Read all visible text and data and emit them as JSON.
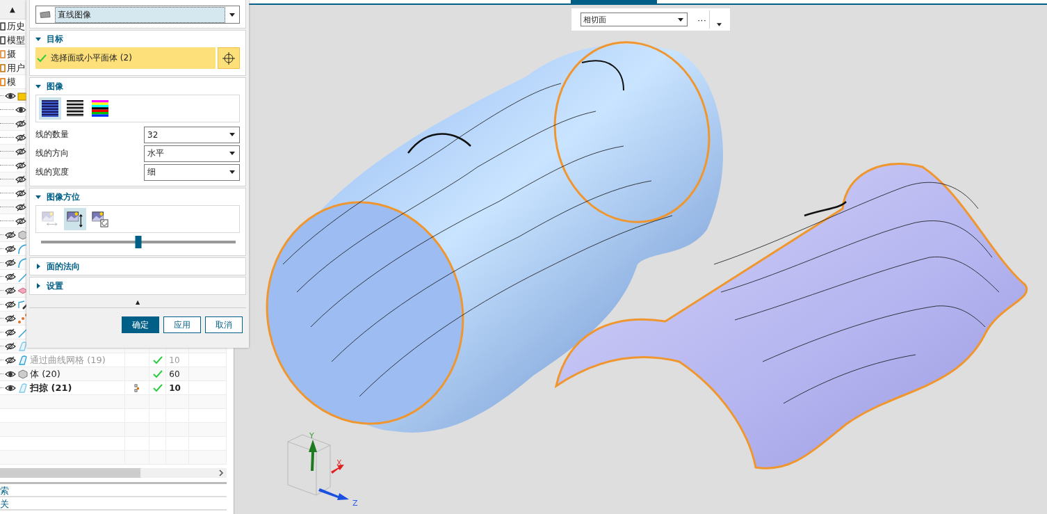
{
  "navigator": {
    "sort_arrow": "▲",
    "rows": [
      {
        "kind": "history",
        "label": "历史"
      },
      {
        "kind": "views",
        "label": "模型"
      },
      {
        "kind": "camera",
        "label": "摄"
      },
      {
        "kind": "expr",
        "label": "用户"
      },
      {
        "kind": "model",
        "label": "模"
      },
      {
        "kind": "folder",
        "shown": true
      },
      {
        "kind": "child",
        "shown": true
      },
      {
        "kind": "child",
        "shown": false
      },
      {
        "kind": "child",
        "shown": false
      },
      {
        "kind": "child",
        "shown": false
      },
      {
        "kind": "child",
        "shown": false
      },
      {
        "kind": "child",
        "shown": false
      },
      {
        "kind": "child",
        "shown": false
      },
      {
        "kind": "child",
        "shown": false
      },
      {
        "kind": "child",
        "shown": false
      },
      {
        "kind": "body",
        "shown": false
      },
      {
        "kind": "arc",
        "shown": false
      },
      {
        "kind": "arc",
        "shown": false
      },
      {
        "kind": "line",
        "shown": false
      },
      {
        "kind": "plane",
        "shown": false
      },
      {
        "kind": "sketch",
        "shown": false
      },
      {
        "kind": "points",
        "shown": false
      },
      {
        "kind": "line",
        "shown": false
      },
      {
        "kind": "sweep",
        "shown": false
      },
      {
        "kind": "mesh",
        "shown": false,
        "label": "通过曲线网格 (19)",
        "disabled": true,
        "current": false,
        "dependency": false,
        "check": true,
        "value": "10"
      },
      {
        "kind": "body",
        "shown": true,
        "label": "体 (20)",
        "disabled": false,
        "current": false,
        "dependency": false,
        "check": true,
        "value": "60"
      },
      {
        "kind": "sweep",
        "shown": true,
        "label": "扫掠 (21)",
        "disabled": false,
        "current": true,
        "dependency": true,
        "check": true,
        "value": "10"
      }
    ],
    "panels": [
      "索",
      "关"
    ]
  },
  "dialog": {
    "type_select": "直线图像",
    "target": {
      "title": "目标",
      "expanded": true,
      "selection": "选择面或小平面体 (2)",
      "complete": true
    },
    "image": {
      "title": "图像",
      "expanded": true,
      "styles": [
        {
          "kind": "blue",
          "selected": true
        },
        {
          "kind": "gray",
          "selected": false
        },
        {
          "kind": "color",
          "selected": false
        }
      ],
      "fields": [
        {
          "label": "线的数量",
          "value": "32"
        },
        {
          "label": "线的方向",
          "value": "水平"
        },
        {
          "label": "线的宽度",
          "value": "细"
        }
      ]
    },
    "orientation": {
      "title": "图像方位",
      "expanded": true,
      "modes": [
        {
          "kind": "pan",
          "selected": false,
          "disabled": true
        },
        {
          "kind": "vertical",
          "selected": true,
          "disabled": false
        },
        {
          "kind": "rotate",
          "selected": false,
          "disabled": false
        }
      ],
      "level": 0.5
    },
    "sections": [
      {
        "title": "面的法向",
        "expanded": false
      },
      {
        "title": "设置",
        "expanded": false
      }
    ],
    "collapse_arrow": "▲",
    "buttons": [
      {
        "label": "确定",
        "primary": true
      },
      {
        "label": "应用",
        "primary": false
      },
      {
        "label": "取消",
        "primary": false
      }
    ]
  },
  "viewport": {
    "face_filter": "相切面",
    "more": "···",
    "axes": [
      "X",
      "Y",
      "Z"
    ]
  }
}
